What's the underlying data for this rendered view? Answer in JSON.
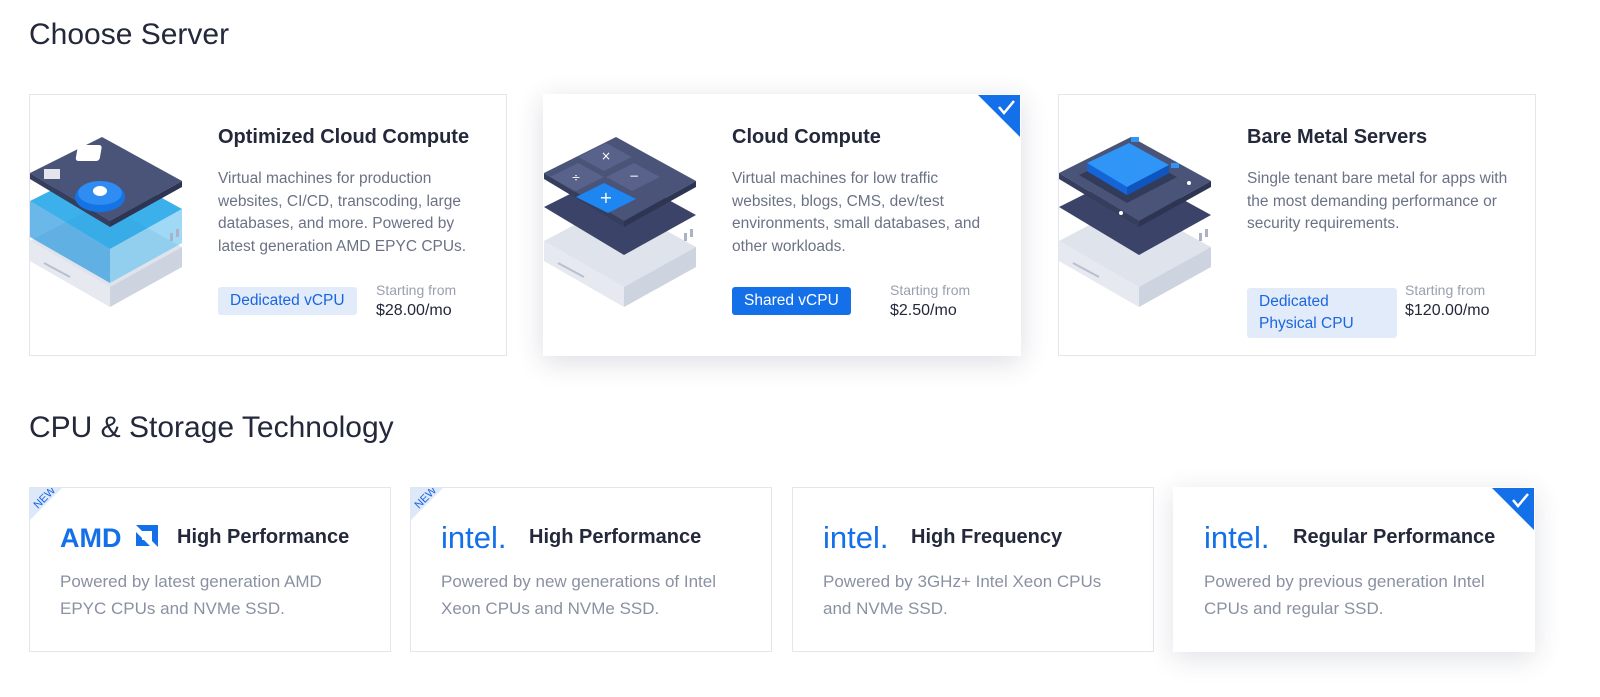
{
  "sections": {
    "server_title": "Choose Server",
    "cpu_title": "CPU & Storage Technology"
  },
  "servers": [
    {
      "title": "Optimized Cloud Compute",
      "description": "Virtual machines for production websites, CI/CD, transcoding, large databases, and more. Powered by latest generation AMD EPYC CPUs.",
      "badge": "Dedicated vCPU",
      "price_label": "Starting from",
      "price": "$28.00/mo",
      "selected": false
    },
    {
      "title": "Cloud Compute",
      "description": "Virtual machines for low traffic websites, blogs, CMS, dev/test environments, small databases, and other workloads.",
      "badge": "Shared vCPU",
      "price_label": "Starting from",
      "price": "$2.50/mo",
      "selected": true
    },
    {
      "title": "Bare Metal Servers",
      "description": "Single tenant bare metal for apps with the most demanding performance or security requirements.",
      "badge": "Dedicated Physical CPU",
      "price_label": "Starting from",
      "price": "$120.00/mo",
      "selected": false
    }
  ],
  "cpu_options": [
    {
      "logo": "AMD",
      "ribbon": "NEW",
      "title": "High Performance",
      "description": "Powered by latest generation AMD EPYC CPUs and NVMe SSD.",
      "selected": false
    },
    {
      "logo": "intel.",
      "ribbon": "NEW",
      "title": "High Performance",
      "description": "Powered by new generations of Intel Xeon CPUs and NVMe SSD.",
      "selected": false
    },
    {
      "logo": "intel.",
      "title": "High Frequency",
      "description": "Powered by 3GHz+ Intel Xeon CPUs and NVMe SSD.",
      "selected": false
    },
    {
      "logo": "intel.",
      "title": "Regular Performance",
      "description": "Powered by previous generation Intel CPUs and regular SSD.",
      "selected": true
    }
  ],
  "colors": {
    "accent": "#1370e8",
    "badge_bg": "#e2ebfa",
    "heading": "#23283a",
    "muted_text": "#6b7286",
    "chip_dark": "#414a6c"
  },
  "icons": [
    "checkmark-icon",
    "new-ribbon",
    "amd-logo",
    "intel-logo",
    "server-illustration"
  ]
}
